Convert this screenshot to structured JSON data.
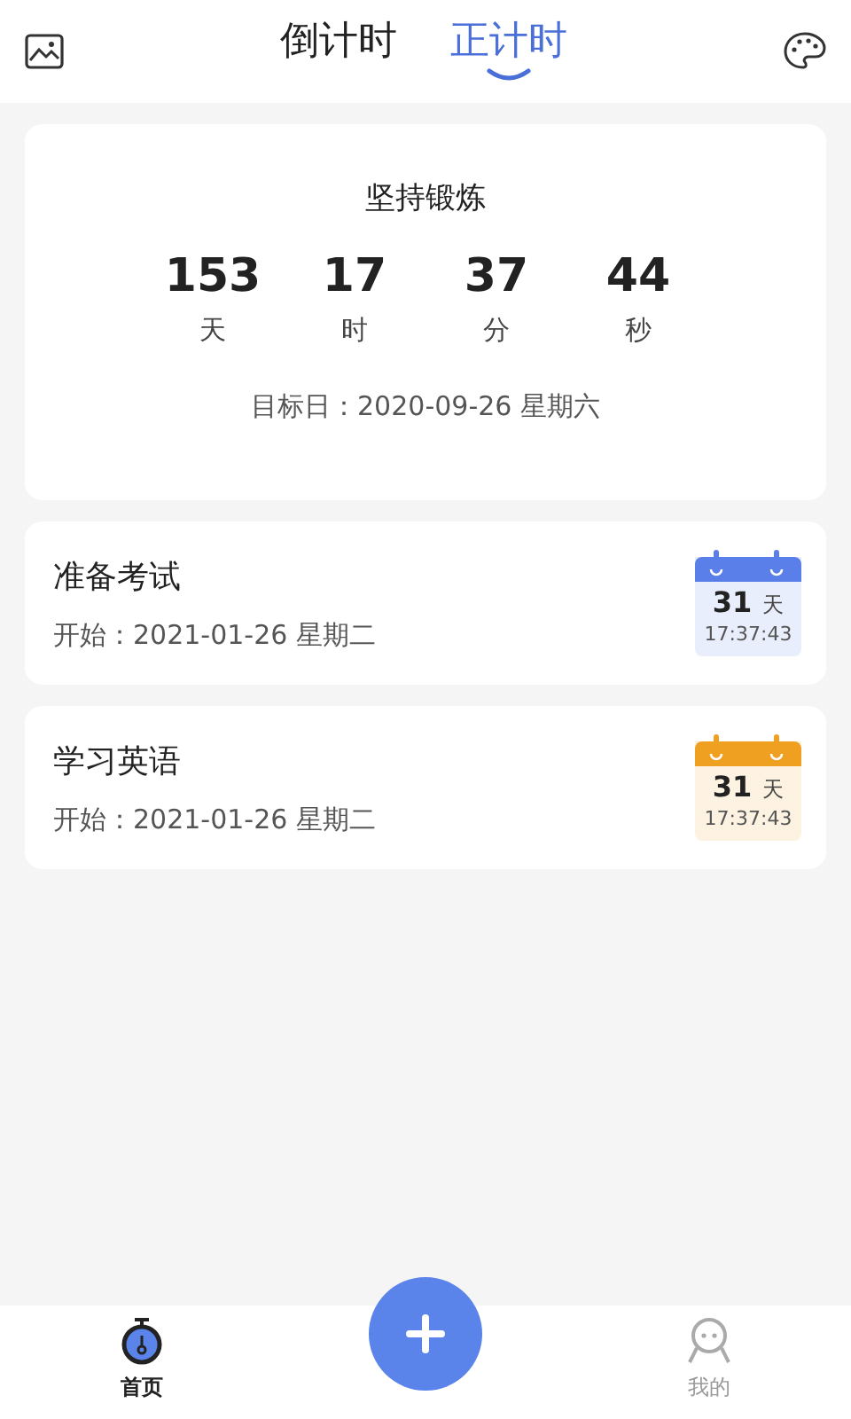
{
  "tabs": [
    {
      "label": "倒计时",
      "selected": false
    },
    {
      "label": "正计时",
      "selected": true
    }
  ],
  "featured": {
    "title": "坚持锻炼",
    "units": [
      {
        "value": "153",
        "unit": "天"
      },
      {
        "value": "17",
        "unit": "时"
      },
      {
        "value": "37",
        "unit": "分"
      },
      {
        "value": "44",
        "unit": "秒"
      }
    ],
    "target": "目标日：2020-09-26  星期六"
  },
  "events": [
    {
      "title": "准备考试",
      "start": "开始：2021-01-26  星期二",
      "days": "31",
      "days_unit": "天",
      "time": "17:37:43",
      "color": "#5b7fe8"
    },
    {
      "title": "学习英语",
      "start": "开始：2021-01-26  星期二",
      "days": "31",
      "days_unit": "天",
      "time": "17:37:43",
      "color": "#f0a020"
    }
  ],
  "bottom_nav": [
    {
      "label": "首页",
      "selected": true
    },
    {
      "label": "我的",
      "selected": false
    }
  ]
}
